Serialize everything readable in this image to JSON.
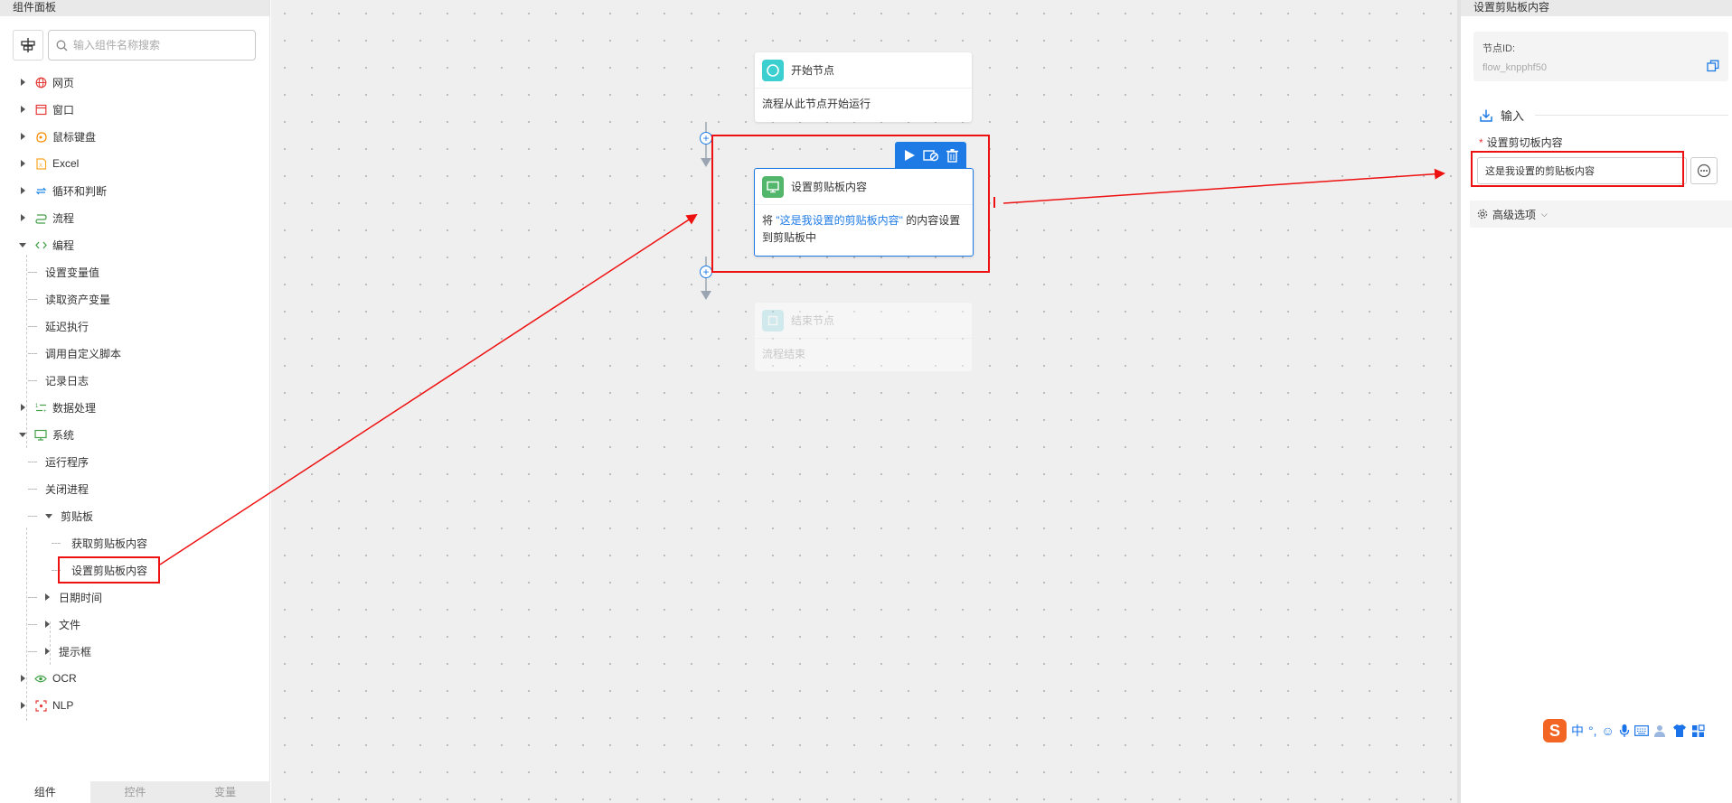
{
  "left_panel": {
    "title": "组件面板",
    "search_placeholder": "输入组件名称搜索",
    "tree": [
      {
        "label": "网页",
        "icon": "globe-icon",
        "color": "#e53935"
      },
      {
        "label": "窗口",
        "icon": "window-icon",
        "color": "#e53935"
      },
      {
        "label": "鼠标键盘",
        "icon": "mouse-keyboard-icon",
        "color": "#fb8c00"
      },
      {
        "label": "Excel",
        "icon": "excel-icon",
        "color": "#fbc02d"
      },
      {
        "label": "循环和判断",
        "icon": "loop-icon",
        "color": "#1e88e5"
      },
      {
        "label": "流程",
        "icon": "flow-icon",
        "color": "#43a047"
      },
      {
        "label": "编程",
        "icon": "code-icon",
        "color": "#43a047"
      },
      {
        "label": "设置变量值"
      },
      {
        "label": "读取资产变量"
      },
      {
        "label": "延迟执行"
      },
      {
        "label": "调用自定义脚本"
      },
      {
        "label": "记录日志"
      },
      {
        "label": "数据处理",
        "icon": "data-icon",
        "color": "#43a047"
      },
      {
        "label": "系统",
        "icon": "monitor-icon",
        "color": "#43a047"
      },
      {
        "label": "运行程序"
      },
      {
        "label": "关闭进程"
      },
      {
        "label": "剪贴板"
      },
      {
        "label": "获取剪贴板内容"
      },
      {
        "label": "设置剪贴板内容"
      },
      {
        "label": "日期时间"
      },
      {
        "label": "文件"
      },
      {
        "label": "提示框"
      },
      {
        "label": "OCR",
        "icon": "eye-icon",
        "color": "#43a047"
      },
      {
        "label": "NLP",
        "icon": "nlp-icon",
        "color": "#e53935"
      }
    ],
    "tabs": [
      "组件",
      "控件",
      "变量"
    ]
  },
  "canvas": {
    "start_node": {
      "title": "开始节点",
      "desc": "流程从此节点开始运行"
    },
    "clip_node": {
      "title": "设置剪贴板内容",
      "desc_prefix": "将 ",
      "desc_value": "\"这是我设置的剪贴板内容\"",
      "desc_suffix": " 的内容设置到剪贴板中"
    },
    "end_node": {
      "title": "结束节点",
      "desc": "流程结束"
    }
  },
  "right_panel": {
    "title": "设置剪贴板内容",
    "node_id_label": "节点ID:",
    "node_id_value": "flow_knpphf50",
    "section_label": "输入",
    "field_required_mark": "*",
    "field_label": "设置剪切板内容",
    "field_value": "这是我设置的剪贴板内容",
    "advanced_label": "高级选项"
  },
  "ime": {
    "cn_label": "中",
    "punct_label": "°,"
  },
  "colors": {
    "accent": "#1e7be5",
    "annotation": "#e11111",
    "canvas_bg": "#efefef"
  }
}
